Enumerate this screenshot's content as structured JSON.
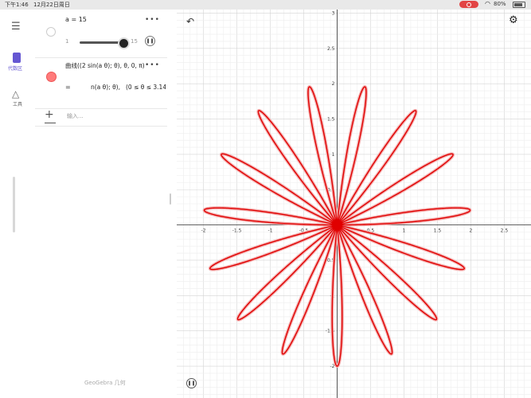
{
  "status_bar": {
    "time": "下午1:46",
    "date": "12月22日周日",
    "battery": "80%"
  },
  "rail": {
    "algebra_label": "代数区",
    "tools_label": "工具"
  },
  "algebra": {
    "slider": {
      "expr": "a  =  15",
      "min": "1",
      "max": "15",
      "value": 15
    },
    "curve": {
      "definition": "曲线((2 sin(a θ); θ), θ, 0, π)",
      "eq_sign": "=",
      "expr": "n(a θ); θ),",
      "range": "(0 ≤ θ ≤ 3.14"
    },
    "input_placeholder": "输入...",
    "menu_dots": "•••"
  },
  "footer": "GeoGebra 几何",
  "colors": {
    "curve": "#e00000",
    "accent": "#6557d2"
  },
  "icons": [
    "menu-icon",
    "calculator-icon",
    "tools-icon",
    "undo-icon",
    "gear-icon",
    "pause-icon",
    "plus-icon"
  ],
  "chart_data": {
    "type": "line",
    "polar_curve": "r = 2 sin(15θ), θ ∈ [0, π]",
    "a": 15,
    "amplitude": 2,
    "theta_range": [
      0,
      3.14159
    ],
    "xlim": [
      -2.4,
      2.9
    ],
    "ylim": [
      -2.45,
      3.05
    ],
    "x_ticks": [
      "-2",
      "-1.5",
      "-1",
      "-0.5",
      "0.5",
      "1",
      "1.5",
      "2",
      "2.5"
    ],
    "x_tick_values": [
      -2,
      -1.5,
      -1,
      -0.5,
      0.5,
      1,
      1.5,
      2,
      2.5
    ],
    "y_ticks": [
      "3",
      "2.5",
      "2",
      "1.5",
      "1",
      "0.5",
      "-0.5",
      "-1",
      "-1.5",
      "-2"
    ],
    "y_tick_values": [
      3,
      2.5,
      2,
      1.5,
      1,
      0.5,
      -0.5,
      -1,
      -1.5,
      -2
    ],
    "grid": true,
    "color": "#e00000"
  }
}
